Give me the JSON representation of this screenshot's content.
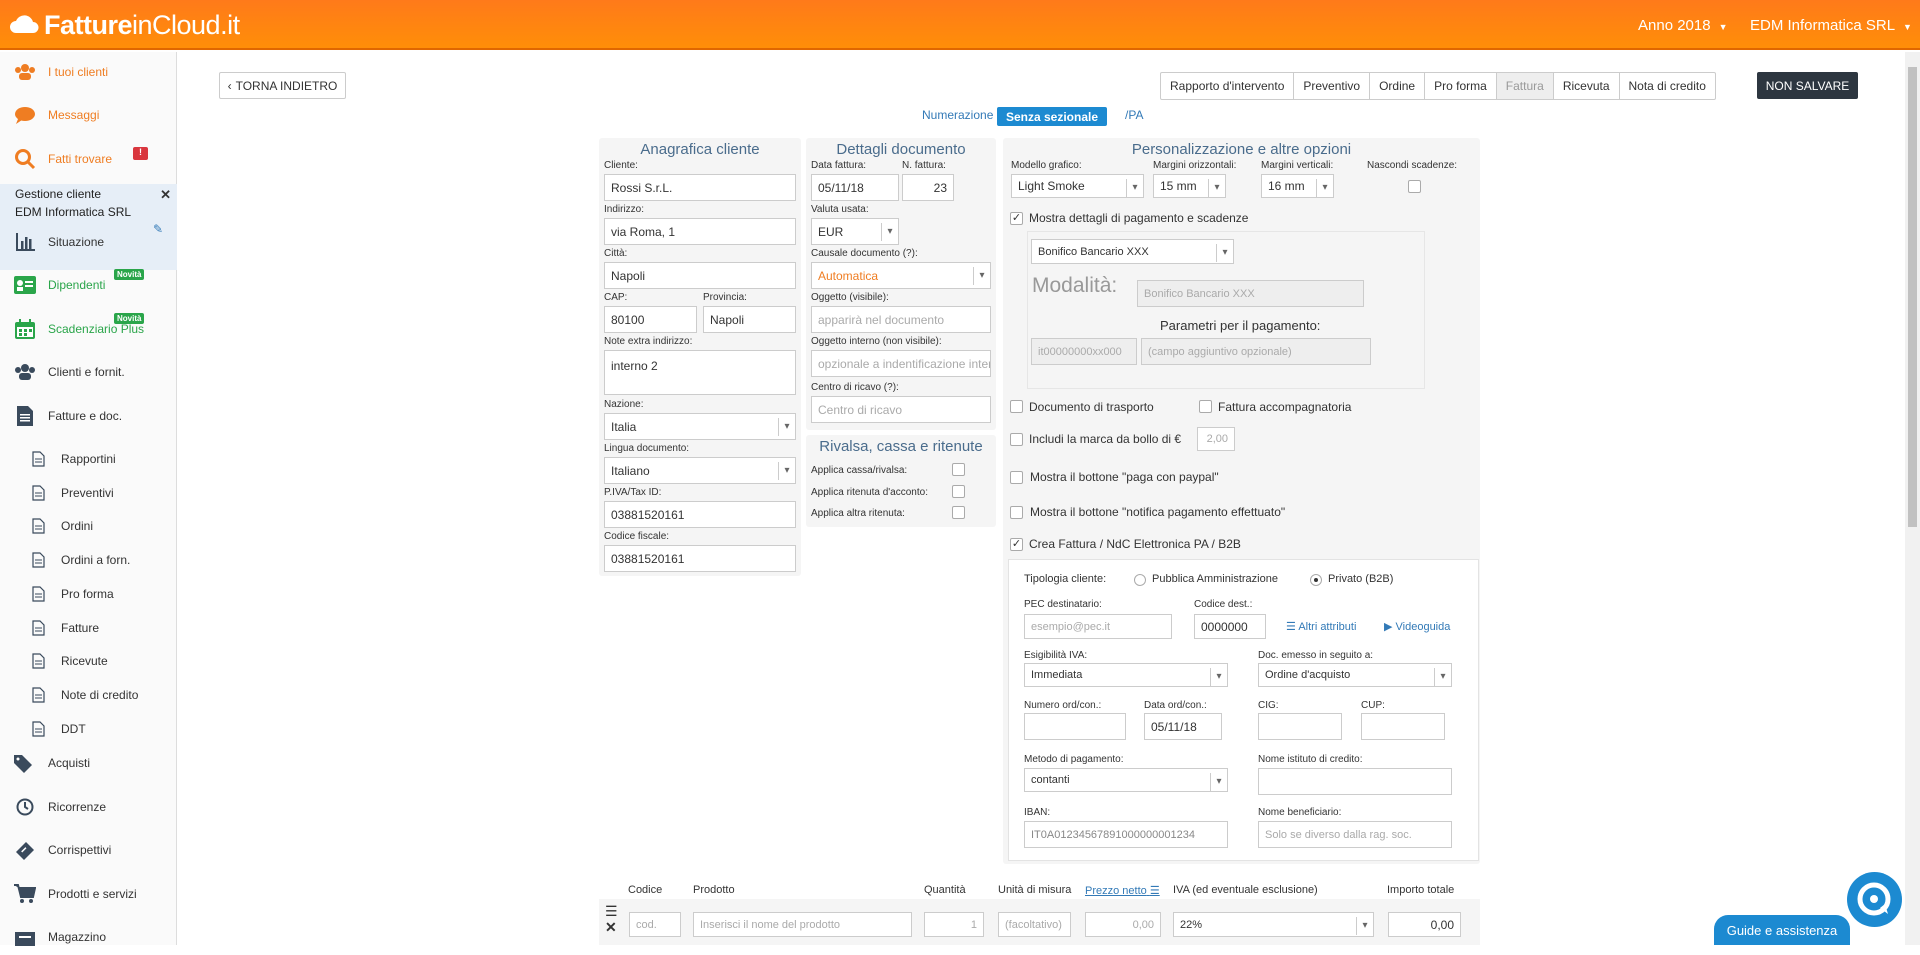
{
  "header": {
    "logo_bold": "Fatture",
    "logo_light": "inCloud.it",
    "year": "Anno 2018",
    "company": "EDM Informatica SRL"
  },
  "sidebar": {
    "top": [
      {
        "label": "I tuoi clienti",
        "icon": "users-icon"
      },
      {
        "label": "Messaggi",
        "icon": "chat-icon"
      },
      {
        "label": "Fatti trovare",
        "icon": "search-icon"
      }
    ],
    "gestione": {
      "title": "Gestione cliente",
      "subtitle": "EDM Informatica SRL"
    },
    "items": [
      {
        "label": "Situazione"
      },
      {
        "label": "Dipendenti",
        "badge": "Novità"
      },
      {
        "label": "Scadenziario Plus",
        "badge": "Novità"
      },
      {
        "label": "Clienti e fornit."
      },
      {
        "label": "Fatture e doc."
      }
    ],
    "subitems": [
      "Rapportini",
      "Preventivi",
      "Ordini",
      "Ordini a forn.",
      "Pro forma",
      "Fatture",
      "Ricevute",
      "Note di credito",
      "DDT"
    ],
    "bottom": [
      "Acquisti",
      "Ricorrenze",
      "Corrispettivi",
      "Prodotti e servizi",
      "Magazzino"
    ]
  },
  "toolbar": {
    "back": "TORNA INDIETRO",
    "tabs": [
      "Rapporto d'intervento",
      "Preventivo",
      "Ordine",
      "Pro forma",
      "Fattura",
      "Ricevuta",
      "Nota di credito"
    ],
    "active_tab": "Fattura",
    "no_save": "NON SALVARE"
  },
  "numerazione": {
    "label": "Numerazione",
    "pill": "Senza sezionale",
    "suffix": "/PA"
  },
  "anagrafica": {
    "title": "Anagrafica cliente",
    "cliente_label": "Cliente:",
    "cliente": "Rossi S.r.L.",
    "indirizzo_label": "Indirizzo:",
    "indirizzo": "via Roma, 1",
    "citta_label": "Città:",
    "citta": "Napoli",
    "cap_label": "CAP:",
    "cap": "80100",
    "provincia_label": "Provincia:",
    "provincia": "Napoli",
    "note_label": "Note extra indirizzo:",
    "note": "interno 2",
    "nazione_label": "Nazione:",
    "nazione": "Italia",
    "lingua_label": "Lingua documento:",
    "lingua": "Italiano",
    "piva_label": "P.IVA/Tax ID:",
    "piva": "03881520161",
    "cf_label": "Codice fiscale:",
    "cf": "03881520161"
  },
  "dettagli": {
    "title": "Dettagli documento",
    "data_label": "Data fattura:",
    "data": "05/11/18",
    "num_label": "N. fattura:",
    "num": "23",
    "valuta_label": "Valuta usata:",
    "valuta": "EUR",
    "causale_label": "Causale documento (?):",
    "causale": "Automatica",
    "oggetto_label": "Oggetto (visibile):",
    "oggetto_ph": "apparirà nel documento",
    "oggetto_int_label": "Oggetto interno (non visibile):",
    "oggetto_int_ph": "opzionale a indentificazione inten",
    "centro_label": "Centro di ricavo (?):",
    "centro_ph": "Centro di ricavo"
  },
  "rivalsa": {
    "title": "Rivalsa, cassa e ritenute",
    "items": [
      "Applica cassa/rivalsa:",
      "Applica ritenuta d'acconto:",
      "Applica altra ritenuta:"
    ]
  },
  "personalizzazione": {
    "title": "Personalizzazione e altre opzioni",
    "modello_label": "Modello grafico:",
    "modello": "Light Smoke",
    "marg_o_label": "Margini orizzontali:",
    "marg_o": "15 mm",
    "marg_v_label": "Margini verticali:",
    "marg_v": "16 mm",
    "nascondi_label": "Nascondi scadenze:",
    "mostra_dettagli": "Mostra dettagli di pagamento e scadenze",
    "bonifico": "Bonifico Bancario XXX",
    "modalita": "Modalità:",
    "modalita_val": "Bonifico Bancario XXX",
    "parametri": "Parametri per il pagamento:",
    "param1": "it00000000xx000",
    "param2": "(campo aggiuntivo opzionale)",
    "doc_trasporto": "Documento di trasporto",
    "fattura_acc": "Fattura accompagnatoria",
    "bollo": "Includi la marca da bollo di €",
    "bollo_val": "2,00",
    "paypal": "Mostra il bottone \"paga con paypal\"",
    "notifica": "Mostra il bottone \"notifica pagamento effettuato\"",
    "crea_pa": "Crea Fattura / NdC Elettronica PA / B2B"
  },
  "pa": {
    "tipologia_label": "Tipologia cliente:",
    "pa_opt": "Pubblica Amministrazione",
    "b2b_opt": "Privato (B2B)",
    "pec_label": "PEC destinatario:",
    "pec_ph": "esempio@pec.it",
    "codice_label": "Codice dest.:",
    "codice": "0000000",
    "altri": "Altri attributi",
    "video": "Videoguida",
    "esig_label": "Esigibilità IVA:",
    "esig": "Immediata",
    "emesso_label": "Doc. emesso in seguito a:",
    "emesso": "Ordine d'acquisto",
    "numord_label": "Numero ord/con.:",
    "dataord_label": "Data ord/con.:",
    "dataord": "05/11/18",
    "cig_label": "CIG:",
    "cup_label": "CUP:",
    "metodo_label": "Metodo di pagamento:",
    "metodo": "contanti",
    "istituto_label": "Nome istituto di credito:",
    "iban_label": "IBAN:",
    "iban": "IT0A01234567891000000001234",
    "benef_label": "Nome beneficiario:",
    "benef_ph": "Solo se diverso dalla rag. soc."
  },
  "products": {
    "headers": [
      "Codice",
      "Prodotto",
      "Quantità",
      "Unità di misura",
      "Prezzo netto",
      "IVA (ed eventuale esclusione)",
      "Importo totale"
    ],
    "cod_ph": "cod.",
    "prod_ph": "Inserisci il nome del prodotto",
    "qty": "1",
    "um_ph": "(facoltativo)",
    "prezzo": "0,00",
    "iva": "22%",
    "importo": "0,00"
  },
  "help": {
    "guide": "Guide e assistenza"
  }
}
